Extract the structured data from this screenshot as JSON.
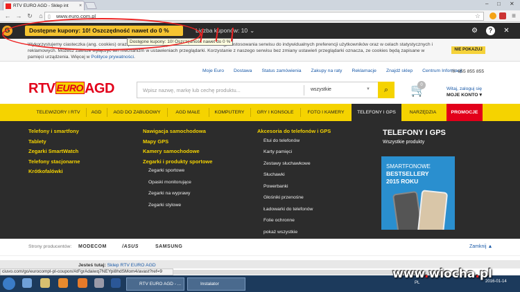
{
  "browser": {
    "tab_title": "RTV EURO AGD - Sklep int",
    "url": "www.euro.com.pl",
    "tab_close": "×"
  },
  "extension": {
    "coupon_banner": "Dostępne kupony: 10! Oszczędność nawet do 0 %",
    "coupon_count": "Liczba kuponów: 10",
    "tooltip": "Dostępne kupony: 10! Oszczędność nawet do 0 %",
    "logo_letter": "G"
  },
  "cookie": {
    "text": "Wykorzystujemy ciasteczka (ang. cookies) oraz podobne technologie w celu świadczenia usług, dostosowania serwisu do indywidualnych preferencji użytkowników oraz w celach statystycznych i reklamowych. Możesz zawsze wyłączyć ten mechanizm w ustawieniach przeglądarki. Korzystanie z naszego serwisu bez zmiany ustawień przeglądarki oznacza, ze cookies będą zapisane w pamięci urządzenia. Więcej w",
    "link": "Polityce prywatności",
    "button": "NIE POKAZUJ"
  },
  "top_links": [
    "Moje Euro",
    "Dostawa",
    "Status zamówienia",
    "Zakupy na raty",
    "Reklamacje",
    "Znajdź sklep",
    "Centrum Informacji"
  ],
  "phone": "855 855 855",
  "logo": {
    "rtv": "RTV",
    "euro": "EURO",
    "agd": "AGD"
  },
  "search": {
    "placeholder": "Wpisz nazwę, markę lub cechę produktu...",
    "category": "wszystkie"
  },
  "cart": {
    "count": "0"
  },
  "account": {
    "login": "Witaj, zaloguj się",
    "label": "MOJE KONTO"
  },
  "categories": [
    "TELEWIZORY I RTV",
    "AGD",
    "AGD DO ZABUDOWY",
    "AGD MAŁE",
    "KOMPUTERY",
    "GRY I KONSOLE",
    "FOTO I KAMERY",
    "TELEFONY I GPS",
    "NARZĘDZIA",
    "PROMOCJE"
  ],
  "mega": {
    "col1": [
      "Telefony i smartfony",
      "Tablety",
      "Zegarki SmartWatch",
      "Telefony stacjonarne",
      "Krótkofalówki"
    ],
    "col2": [
      "Nawigacja samochodowa",
      "Mapy GPS",
      "Kamery samochodowe",
      "Zegarki i produkty sportowe"
    ],
    "col2_sub": [
      "Zegarki sportowe",
      "Opaski monitorujące",
      "Zegarki na wyprawy",
      "Zegarki stylowe"
    ],
    "col3_head": "Akcesoria do telefonów i GPS",
    "col3": [
      "Etui do telefonów",
      "Karty pamięci",
      "Zestawy słuchawkowe",
      "Słuchawki",
      "Powerbanki",
      "Głośniki przenośne",
      "Ładowarki do telefonów",
      "Folie ochronne",
      "pokaż wszystkie"
    ],
    "promo_title": "TELEFONY I GPS",
    "promo_sub": "Wszystkie produkty",
    "banner_l1": "SMARTFONOWE",
    "banner_l2": "BESTSELLERY",
    "banner_l3": "2015 ROKU"
  },
  "brands": {
    "label": "Strony producentów:",
    "items": [
      "MODECOM",
      "/ASUS",
      "SAMSUNG"
    ],
    "collapse": "Zamknij ▲"
  },
  "breadcrumb": {
    "label": "Jesteś tutaj:",
    "link": "Sklep RTV EURO AGD"
  },
  "status_url": "ciuvo.com/go/eurocompl-pl-coupon/AtFgrAdaiwq7NEYpi8hdSMom4/avast?ref=9",
  "taskbar": {
    "chrome_task": "RTV EURO AGD - ...",
    "installer_task": "Instalator",
    "lang": "PL",
    "time": "2016-01-14"
  },
  "watermark": {
    "prefix": "www",
    "name": "wiocha",
    "suffix": "pl"
  },
  "colors": {
    "accent_yellow": "#f5d300",
    "brand_red": "#e2001a",
    "dark_menu": "#2c2c2c"
  }
}
